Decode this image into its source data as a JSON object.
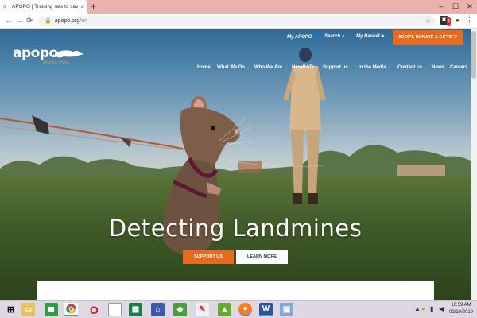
{
  "browser": {
    "tab_title": "APOPO | Training rats to save liv",
    "tab_favicon": "rat-favicon-icon",
    "new_tab": "+",
    "window_controls": {
      "minimize": "–",
      "maximize": "☐",
      "close": "✕"
    },
    "url_domain": "apopo.org",
    "url_path": "/en",
    "nav": {
      "back": "←",
      "forward": "→",
      "reload": "⟳"
    }
  },
  "site": {
    "logo_text": "apopo",
    "logo_tagline": "SAVING LIVES",
    "utility_nav": {
      "my_apopo": "My APOPO",
      "search": "Search",
      "my_basket": "My Basket",
      "cta": "ADOPT, DONATE & GIFTS"
    },
    "main_nav": [
      {
        "label": "Home",
        "dropdown": false
      },
      {
        "label": "What We Do",
        "dropdown": true
      },
      {
        "label": "Who We Are",
        "dropdown": true
      },
      {
        "label": "HeroRATs",
        "dropdown": true
      },
      {
        "label": "Support us",
        "dropdown": true
      },
      {
        "label": "In the Media",
        "dropdown": true
      },
      {
        "label": "Contact us",
        "dropdown": true
      },
      {
        "label": "News",
        "dropdown": false
      },
      {
        "label": "Careers",
        "dropdown": false
      }
    ],
    "hero": {
      "title": "Detecting Landmines",
      "support_button": "SUPPORT US",
      "learn_button": "LEARN MORE"
    },
    "colors": {
      "accent": "#e86a1c",
      "logo_accent": "#f2a24a"
    }
  },
  "taskbar": {
    "icons": [
      "windows-start-icon",
      "file-explorer-icon",
      "store-icon",
      "chrome-icon",
      "opera-icon",
      "blank-document-icon",
      "excel-icon",
      "network-icon",
      "green-app-icon",
      "paint-icon",
      "media-icon",
      "firefox-icon",
      "word-icon",
      "photos-icon"
    ],
    "time": "10:59 AM",
    "date": "02/10/2019",
    "tray_chevron": "▲"
  }
}
